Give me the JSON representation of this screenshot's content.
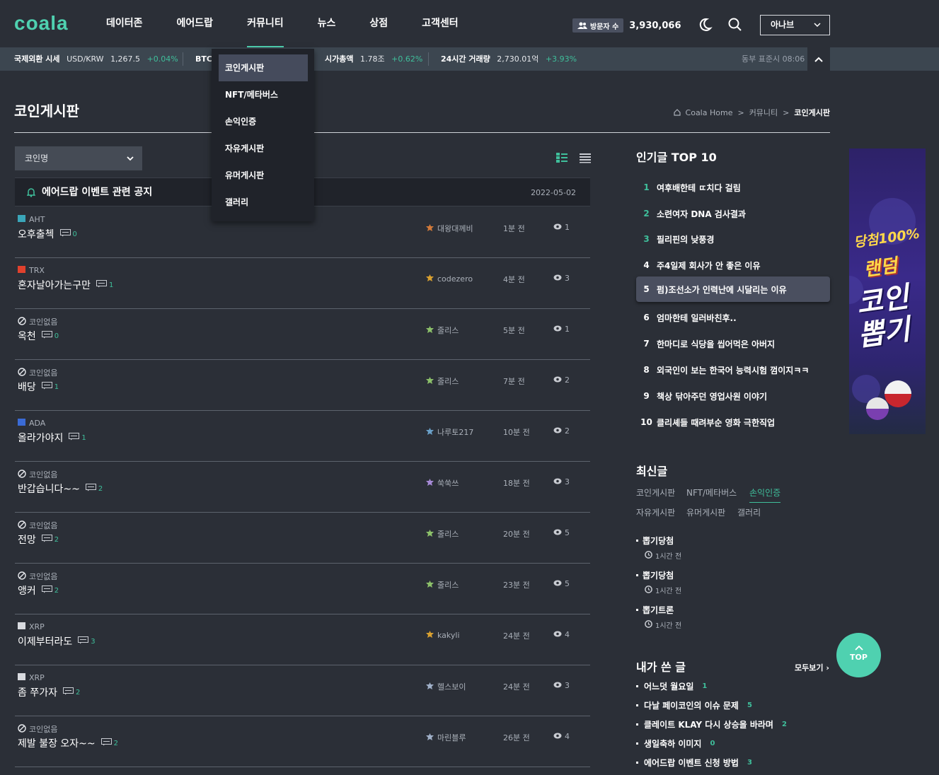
{
  "brand": {
    "logo": "coala",
    "accent": "#4fd1b0"
  },
  "nav": [
    "데이터존",
    "에어드랍",
    "커뮤니티",
    "뉴스",
    "상점",
    "고객센터"
  ],
  "header": {
    "visitor_label": "방문자 수",
    "visitor_count": "3,930,066",
    "language": "아나브"
  },
  "ticker": {
    "forex_label": "국제외환 시세",
    "forex_pair": "USD/KRW",
    "forex_value": "1,267.5",
    "forex_change": "+0.04%",
    "btc_label": "BTC",
    "cap_label": "시가총액",
    "cap_value": "1.78조",
    "cap_change": "+0.62%",
    "vol_label": "24시간 거래량",
    "vol_value": "2,730.01억",
    "vol_change": "+3.93%",
    "time": "동부 표준시 08:06"
  },
  "dropdown": [
    "코인게시판",
    "NFT/메타버스",
    "손익인증",
    "자유게시판",
    "유머게시판",
    "갤러리"
  ],
  "page": {
    "title": "코인게시판",
    "breadcrumb": [
      "Coala Home",
      "커뮤니티",
      "코인게시판"
    ],
    "filter": "코인명"
  },
  "notice": {
    "title": "에어드랍 이벤트 관련 공지",
    "date": "2022-05-02"
  },
  "posts": [
    {
      "coin": "AHT",
      "title": "오후출첵",
      "comments": "0",
      "author": "대왕대께비",
      "time": "1분 전",
      "views": "1"
    },
    {
      "coin": "TRX",
      "title": "혼자날아가는구만",
      "comments": "1",
      "author": "codezero",
      "time": "4분 전",
      "views": "3"
    },
    {
      "coin": "코인없음",
      "title": "옥천",
      "comments": "0",
      "author": "줄리스",
      "time": "5분 전",
      "views": "1"
    },
    {
      "coin": "코인없음",
      "title": "배당",
      "comments": "1",
      "author": "줄리스",
      "time": "7분 전",
      "views": "2"
    },
    {
      "coin": "ADA",
      "title": "올라가야지",
      "comments": "1",
      "author": "나루토217",
      "time": "10분 전",
      "views": "2"
    },
    {
      "coin": "코인없음",
      "title": "반갑습니다~~",
      "comments": "2",
      "author": "쑥쑥쓰",
      "time": "18분 전",
      "views": "3"
    },
    {
      "coin": "코인없음",
      "title": "전망",
      "comments": "2",
      "author": "줄리스",
      "time": "20분 전",
      "views": "5"
    },
    {
      "coin": "코인없음",
      "title": "앵커",
      "comments": "2",
      "author": "줄리스",
      "time": "23분 전",
      "views": "5"
    },
    {
      "coin": "XRP",
      "title": "이제부터라도",
      "comments": "3",
      "author": "kakyli",
      "time": "24분 전",
      "views": "4"
    },
    {
      "coin": "XRP",
      "title": "좀 쭈가자",
      "comments": "2",
      "author": "헬스보이",
      "time": "24분 전",
      "views": "3"
    },
    {
      "coin": "코인없음",
      "title": "제발 불장 오자~~",
      "comments": "2",
      "author": "마린블루",
      "time": "26분 전",
      "views": "4"
    }
  ],
  "popular": {
    "title": "인기글 TOP 10",
    "items": [
      {
        "rank": "1",
        "title": "여후배한테 ㄸ치다 걸림"
      },
      {
        "rank": "2",
        "title": "소련여자 DNA 검사결과"
      },
      {
        "rank": "3",
        "title": "필리핀의 낮풍경"
      },
      {
        "rank": "4",
        "title": "주4일제 회사가 안 좋은 이유"
      },
      {
        "rank": "5",
        "title": "펌)조선소가 인력난에 시달리는 이유"
      },
      {
        "rank": "6",
        "title": "엄마한테 일러바친후.."
      },
      {
        "rank": "7",
        "title": "한마디로 식당을 씹어먹은 아버지"
      },
      {
        "rank": "8",
        "title": "외국인이 보는 한국어 능력시험 껌이지ㅋㅋ"
      },
      {
        "rank": "9",
        "title": "책상 닦아주던 영업사원 이야기"
      },
      {
        "rank": "10",
        "title": "클리셰들 때려부순 영화 극한직업"
      }
    ]
  },
  "latest": {
    "title": "최신글",
    "tabs": [
      "코인게시판",
      "NFT/메타버스",
      "손익인증",
      "자유게시판",
      "유머게시판",
      "갤러리"
    ],
    "items": [
      {
        "title": "뽑기당첨",
        "time": "1시간 전"
      },
      {
        "title": "뽑기당첨",
        "time": "1시간 전"
      },
      {
        "title": "뽑기트론",
        "time": "1시간 전"
      }
    ]
  },
  "my_posts": {
    "title": "내가 쓴 글",
    "more": "모두보기",
    "items": [
      {
        "title": "어느덧 월요일",
        "comments": "1"
      },
      {
        "title": "다날 페이코인의 이슈 문제",
        "comments": "5"
      },
      {
        "title": "클레이트 KLAY 다시 상승을 바라며",
        "comments": "2"
      },
      {
        "title": "생일축하 이미지",
        "comments": "0"
      },
      {
        "title": "에어드랍 이벤트 신청 방법",
        "comments": "3"
      }
    ]
  },
  "ad": {
    "tag": "당첨100%",
    "line1": "랜덤",
    "line2": "코인",
    "line3": "뽑기"
  },
  "top_button": "TOP"
}
